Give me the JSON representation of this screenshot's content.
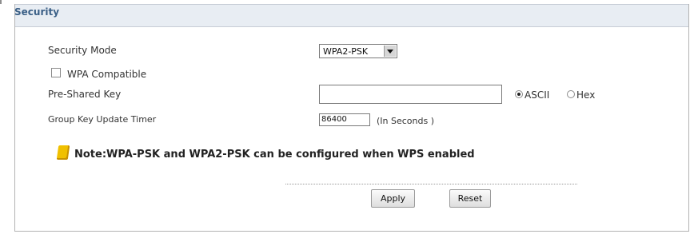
{
  "security_section": {
    "title": "Security",
    "security_mode": {
      "label": "Security Mode",
      "selected": "WPA2-PSK"
    },
    "wpa_compatible": {
      "label": "WPA Compatible",
      "checked": false
    },
    "pre_shared_key": {
      "label": "Pre-Shared Key",
      "value": "",
      "encoding_options": [
        "ASCII",
        "Hex"
      ],
      "selected_encoding": "ASCII"
    },
    "group_key_update_timer": {
      "label": "Group Key Update Timer",
      "value": "86400",
      "unit": "(In Seconds )"
    },
    "note": "Note:WPA-PSK and WPA2-PSK can be configured when WPS enabled",
    "buttons": {
      "apply": "Apply",
      "reset": "Reset"
    }
  }
}
